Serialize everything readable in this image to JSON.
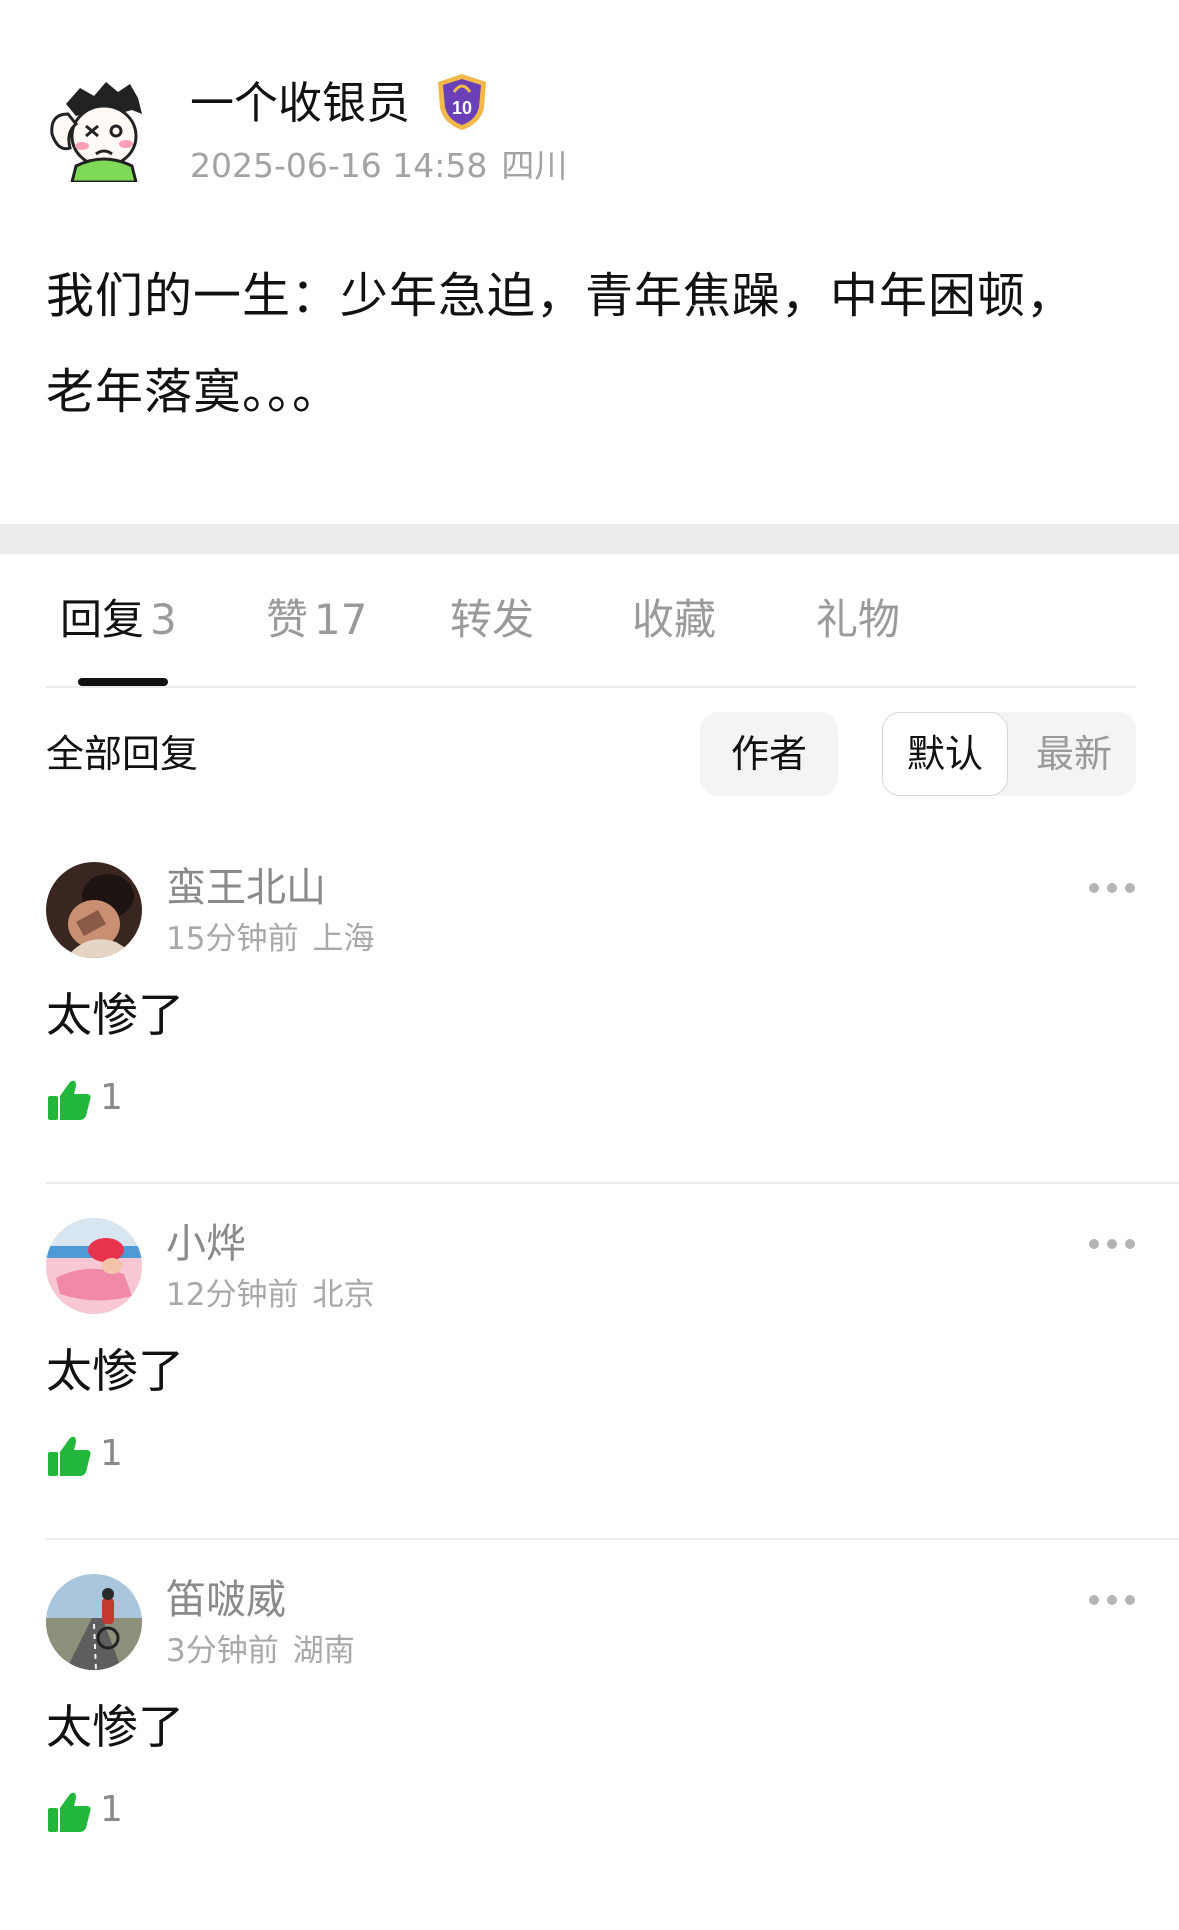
{
  "post": {
    "author_name": "一个收银员",
    "level_badge": "10",
    "timestamp": "2025-06-16 14:58",
    "location": "四川",
    "body_line1": "我们的一生：少年急迫，青年焦躁，中年困顿，",
    "body_line2": "老年落寞。。。"
  },
  "tabs": [
    {
      "label": "回复",
      "count": "3"
    },
    {
      "label": "赞",
      "count": "17"
    },
    {
      "label": "转发"
    },
    {
      "label": "收藏"
    },
    {
      "label": "礼物"
    }
  ],
  "filter": {
    "all_replies_label": "全部回复",
    "author_label": "作者",
    "sort_default_label": "默认",
    "sort_latest_label": "最新"
  },
  "comments": [
    {
      "name": "蛮王北山",
      "time": "15分钟前",
      "location": "上海",
      "text": "太惨了",
      "likes": "1"
    },
    {
      "name": "小烨",
      "time": "12分钟前",
      "location": "北京",
      "text": "太惨了",
      "likes": "1"
    },
    {
      "name": "笛啵威",
      "time": "3分钟前",
      "location": "湖南",
      "text": "太惨了",
      "likes": "1"
    }
  ],
  "colors": {
    "like_green": "#22b63a",
    "badge_purple": "#6b3fb8",
    "badge_gold": "#f0b94a"
  },
  "icons": {
    "more": "more-dots-icon",
    "like": "thumbs-up-icon",
    "badge": "level-shield-icon"
  }
}
